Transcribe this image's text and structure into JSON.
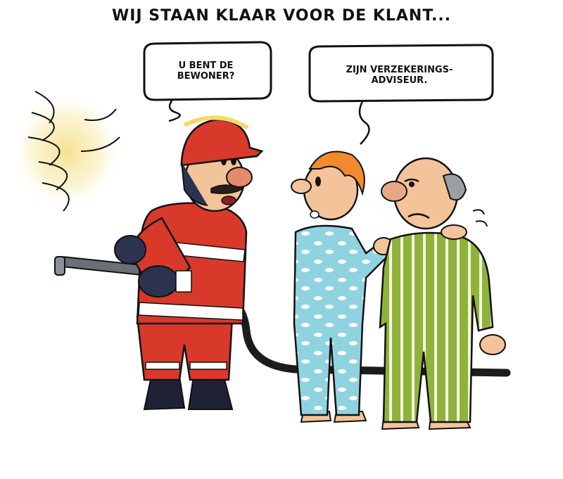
{
  "caption": "WIJ STAAN KLAAR VOOR DE KLANT...",
  "balloons": {
    "firefighter_line1": "U BENT DE",
    "firefighter_line2": "BEWONER?",
    "man_line1": "ZIJN VERZEKERINGS-",
    "man_line2": "ADVISEUR."
  },
  "colors": {
    "firefighter_red": "#d9392b",
    "reflective_white": "#ffffff",
    "glove_navy": "#2b3350",
    "pajama_blue": "#8fd3e0",
    "pajama_green": "#8fb33a",
    "skin": "#f3c39a",
    "hair_orange": "#f08a2c",
    "glow_yellow": "#f5e08a"
  }
}
